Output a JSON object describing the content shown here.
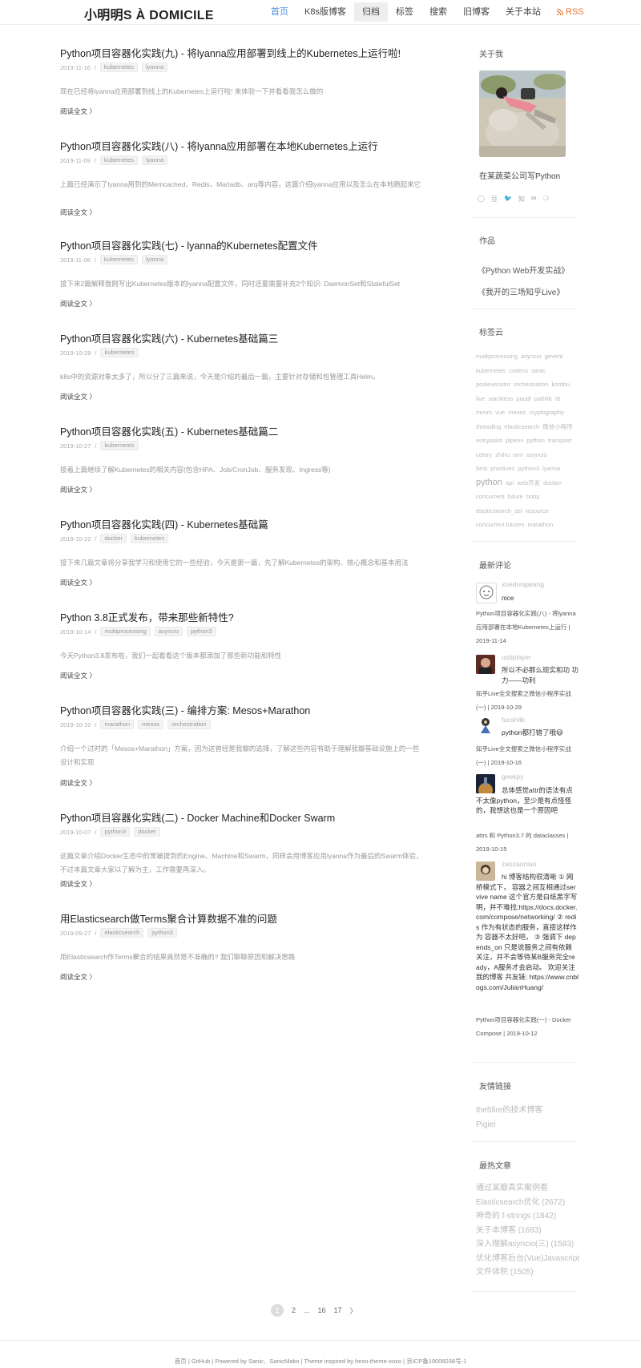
{
  "site": {
    "brand": "小明明S À DOMICILE",
    "nav": [
      {
        "label": "首页"
      },
      {
        "label": "K8s版博客"
      },
      {
        "label": "归档"
      },
      {
        "label": "标签"
      },
      {
        "label": "搜索"
      },
      {
        "label": "旧博客"
      },
      {
        "label": "关于本站"
      },
      {
        "label": "RSS"
      }
    ]
  },
  "posts": [
    {
      "title": "Python项目容器化实践(九) - 将lyanna应用部署到线上的Kubernetes上运行啦!",
      "date": "2019-11-16",
      "tags": [
        "kubernetes",
        "lyanna"
      ],
      "excerpt": "现在已经将lyanna应用部署到线上的Kubernetes上运行啦! 来体验一下并看看我怎么做的",
      "readmore": "阅读全文 〉"
    },
    {
      "title": "Python项目容器化实践(八) - 将lyanna应用部署在本地Kubernetes上运行",
      "date": "2019-11-09",
      "tags": [
        "kubernetes",
        "lyanna"
      ],
      "excerpt": "上篇已经演示了lyanna用到的Memcached、Redis、Mariadb、arq等内容，这篇介绍lyanna应用以及怎么在本地跑起来它",
      "readmore": "阅读全文 〉"
    },
    {
      "title": "Python项目容器化实践(七) - lyanna的Kubernetes配置文件",
      "date": "2019-11-08",
      "tags": [
        "kubernetes",
        "lyanna"
      ],
      "excerpt": "接下来2篇解释我刚写出Kubernetes版本的lyanna配置文件，同时还要需要补充2个知识: DaemonSet和StatefulSet",
      "readmore": "阅读全文 〉"
    },
    {
      "title": "Python项目容器化实践(六) - Kubernetes基础篇三",
      "date": "2019-10-29",
      "tags": [
        "kubernetes"
      ],
      "excerpt": "k8s中的资源对象太多了，所以分了三篇来说，今天是介绍的最后一篇，主要针对存储和包管理工具Helm。",
      "readmore": "阅读全文 〉"
    },
    {
      "title": "Python项目容器化实践(五) - Kubernetes基础篇二",
      "date": "2019-10-27",
      "tags": [
        "kubernetes"
      ],
      "excerpt": "接着上篇继续了解Kubernetes的相关内容(包含HPA、Job/CronJob、服务发现、Ingress等)",
      "readmore": "阅读全文 〉"
    },
    {
      "title": "Python项目容器化实践(四) - Kubernetes基础篇",
      "date": "2019-10-22",
      "tags": [
        "docker",
        "kubernetes"
      ],
      "excerpt": "接下来几篇文章将分享我学习和使用它的一些经验，今天是第一篇，先了解Kubernetes的架构、核心概念和基本用法",
      "readmore": "阅读全文 〉"
    },
    {
      "title": "Python 3.8正式发布，带来那些新特性?",
      "date": "2019-10-14",
      "tags": [
        "multiprocessing",
        "asyncio",
        "python3"
      ],
      "excerpt": "今天Python3.8发布啦，我们一起看看这个版本都添加了那些新功能和特性",
      "readmore": "阅读全文 〉"
    },
    {
      "title": "Python项目容器化实践(三) - 编排方案: Mesos+Marathon",
      "date": "2019-10-10",
      "tags": [
        "marathon",
        "mesos",
        "orchestration"
      ],
      "excerpt": "介绍一个过时的「Mesos+Marathon」方案，因为这曾经是我瓣的选择，了解这些内容有助于理解我瓣基础设施上的一些设计和实现",
      "readmore": "阅读全文 〉"
    },
    {
      "title": "Python项目容器化实践(二) - Docker Machine和Docker Swarm",
      "date": "2019-10-07",
      "tags": [
        "python3",
        "docker"
      ],
      "excerpt": "这篇文章介绍Docker生态中的常被提到的Engine、Machine和Swarm，同样会用博客应用lyanna作为最后的Swarm体验，不过本篇文章大家以了解为主，工作需要再深入。",
      "readmore": "阅读全文 〉"
    },
    {
      "title": "用Elasticsearch做Terms聚合计算数据不准的问题",
      "date": "2019-09-27",
      "tags": [
        "elasticsearch",
        "python3"
      ],
      "excerpt": "用Elasticsearch作Terms聚合的结果竟然是不准确的? 我们聊聊原因和解决思路",
      "readmore": "阅读全文 〉"
    }
  ],
  "sidebar": {
    "about": {
      "title": "关于我",
      "bio": "在某蔬菜公司写Python",
      "social_icons": [
        "github-icon",
        "douban-icon",
        "twitter-icon",
        "zhihu-icon",
        "email-icon",
        "weibo-icon"
      ],
      "social_glyphs": [
        "◯",
        "豆",
        "🐦",
        "知",
        "✉",
        "❍"
      ]
    },
    "works": {
      "title": "作品",
      "items": [
        "《Python Web开发实战》",
        "《我开的三场知乎Live》"
      ]
    },
    "tags": {
      "title": "标签云",
      "items": [
        "multiprocessing",
        "asyncio",
        "gevent",
        "kubernetes",
        "codecs",
        "sanic",
        "poolexecutor",
        "orchestration",
        "kombu",
        "live",
        "stackless",
        "paudl",
        "pathlib",
        "ttt",
        "mvvm",
        "vue",
        "mesos",
        "cryptography",
        "threading",
        "elasticsearch",
        "微信小程序",
        "entrypoint",
        "pipenv",
        "python",
        "transport",
        "celery",
        "zhihu",
        "orm",
        "asyncio",
        "best practices",
        "python3",
        "lyanna",
        "python",
        "api",
        "web开发",
        "docker",
        "concurrent",
        "future",
        "bobp",
        "elasticsearch_dsl",
        "resource",
        "concurrent.futures",
        "marathon"
      ]
    },
    "comments": {
      "title": "最新评论",
      "items": [
        {
          "user": "xuedongwang",
          "text": "nice",
          "ref": "Python项目容器化实践(八) - 将lyanna应用部署在本地Kubernetes上运行 | 2019-11-14"
        },
        {
          "user": "usbplayer",
          "text": "所以不必那么现实和功 功力——功利",
          "ref": "知乎Live全文搜索之微信小程序实战(一) | 2019-10-29"
        },
        {
          "user": "fucshitk",
          "text": "python都打错了哦😄",
          "ref": "知乎Live全文搜索之微信小程序实战(一) | 2019-10-16"
        },
        {
          "user": "geekpy",
          "text": "总体感觉attr的语法有点不太像python，至少是有点怪怪的，我想这也是一个原因吧",
          "ref": "attrs 和 Python3.7 的 dataclasses | 2019-10-15"
        },
        {
          "user": "zaozaoniao",
          "text": "hi 博客结构很清晰 ① 网桥模式下， 容器之间互相通过servive name 这个官方是白纸黑字写明，并不难找;https://docs.docker.com/compose/networking/ ② redis 作为有状态的服务，直接这样作为 容器不太好吧， ③ 强调下 depends_on 只是说服务之间有依赖关注，并不会等待某B服务完全ready，A服务才会启动。 欢迎关注我的博客 共友链: https://www.cnblogs.com/JulianHuang/",
          "ref": "Python项目容器化实践(一) - Docker Compose | 2019-10-12"
        }
      ]
    },
    "links": {
      "title": "友情链接",
      "items": [
        "the5fire的技术博客",
        "Pigiei"
      ]
    },
    "popular": {
      "title": "最热文章",
      "items": [
        "通过某瓣真实案例看Elasticsearch优化 (2672)",
        "神奇的 f-strings (1842)",
        "关于本博客 (1693)",
        "深入理解asyncio(三) (1583)",
        "优化博客后台(Vue)Javascript文件体积 (1505)"
      ]
    }
  },
  "pagination": {
    "pages": [
      "1",
      "2",
      "...",
      "16",
      "17",
      "〉"
    ],
    "current": "1"
  },
  "footer": {
    "text": "首页  |  GitHub  | Powered by Sanic、SanicMako | Theme inspired by hexo-theme-xoxo | 京ICP备19006038号-1"
  }
}
